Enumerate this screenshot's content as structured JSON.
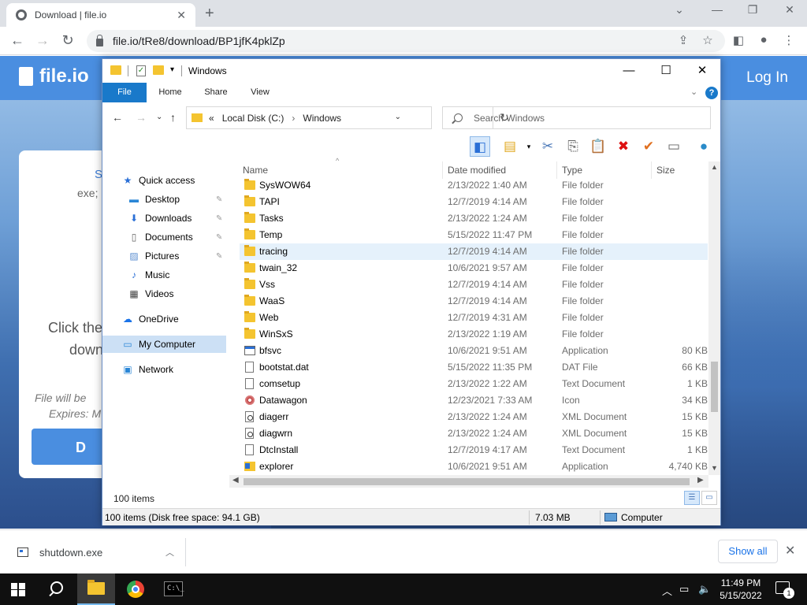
{
  "browser": {
    "tab_title": "Download | file.io",
    "tab_close": "✕",
    "new_tab": "+",
    "url": "file.io/tRe8/download/BP1jfK4pklZp",
    "controls": {
      "minimize": "⌄",
      "minimize2": "—",
      "restore": "❐",
      "close": "✕"
    }
  },
  "page": {
    "logo": "file.io",
    "login": "Log In",
    "card": {
      "line1": "S",
      "line2": "exe;",
      "line3": "Click the",
      "line4": "down",
      "line5": "File will be",
      "line6": "Expires: M",
      "download_btn": "D"
    }
  },
  "explorer": {
    "title": "Windows",
    "ribbon_tabs": [
      "File",
      "Home",
      "Share",
      "View"
    ],
    "help": "?",
    "address": {
      "crumb_prefix": "«",
      "crumbs": [
        "Local Disk (C:)",
        "Windows"
      ]
    },
    "search_placeholder": "Search Windows",
    "nav": {
      "quick_access": "Quick access",
      "desktop": "Desktop",
      "downloads": "Downloads",
      "documents": "Documents",
      "pictures": "Pictures",
      "music": "Music",
      "videos": "Videos",
      "onedrive": "OneDrive",
      "my_computer": "My Computer",
      "network": "Network"
    },
    "columns": {
      "name": "Name",
      "date": "Date modified",
      "type": "Type",
      "size": "Size"
    },
    "files": [
      {
        "name": "SysWOW64",
        "date": "2/13/2022 1:40 AM",
        "type": "File folder",
        "size": "",
        "icon": "folder"
      },
      {
        "name": "TAPI",
        "date": "12/7/2019 4:14 AM",
        "type": "File folder",
        "size": "",
        "icon": "folder"
      },
      {
        "name": "Tasks",
        "date": "2/13/2022 1:24 AM",
        "type": "File folder",
        "size": "",
        "icon": "folder"
      },
      {
        "name": "Temp",
        "date": "5/15/2022 11:47 PM",
        "type": "File folder",
        "size": "",
        "icon": "folder"
      },
      {
        "name": "tracing",
        "date": "12/7/2019 4:14 AM",
        "type": "File folder",
        "size": "",
        "icon": "folder"
      },
      {
        "name": "twain_32",
        "date": "10/6/2021 9:57 AM",
        "type": "File folder",
        "size": "",
        "icon": "folder"
      },
      {
        "name": "Vss",
        "date": "12/7/2019 4:14 AM",
        "type": "File folder",
        "size": "",
        "icon": "folder"
      },
      {
        "name": "WaaS",
        "date": "12/7/2019 4:14 AM",
        "type": "File folder",
        "size": "",
        "icon": "folder"
      },
      {
        "name": "Web",
        "date": "12/7/2019 4:31 AM",
        "type": "File folder",
        "size": "",
        "icon": "folder"
      },
      {
        "name": "WinSxS",
        "date": "2/13/2022 1:19 AM",
        "type": "File folder",
        "size": "",
        "icon": "folder"
      },
      {
        "name": "bfsvc",
        "date": "10/6/2021 9:51 AM",
        "type": "Application",
        "size": "80 KB",
        "icon": "app"
      },
      {
        "name": "bootstat.dat",
        "date": "5/15/2022 11:35 PM",
        "type": "DAT File",
        "size": "66 KB",
        "icon": "doc"
      },
      {
        "name": "comsetup",
        "date": "2/13/2022 1:22 AM",
        "type": "Text Document",
        "size": "1 KB",
        "icon": "doc"
      },
      {
        "name": "Datawagon",
        "date": "12/23/2021 7:33 AM",
        "type": "Icon",
        "size": "34 KB",
        "icon": "icon"
      },
      {
        "name": "diagerr",
        "date": "2/13/2022 1:24 AM",
        "type": "XML Document",
        "size": "15 KB",
        "icon": "xml"
      },
      {
        "name": "diagwrn",
        "date": "2/13/2022 1:24 AM",
        "type": "XML Document",
        "size": "15 KB",
        "icon": "xml"
      },
      {
        "name": "DtcInstall",
        "date": "12/7/2019 4:17 AM",
        "type": "Text Document",
        "size": "1 KB",
        "icon": "doc"
      },
      {
        "name": "explorer",
        "date": "10/6/2021 9:51 AM",
        "type": "Application",
        "size": "4,740 KB",
        "icon": "explorer"
      }
    ],
    "highlighted_file": "tracing",
    "item_count": "100 items",
    "status": {
      "disk": "100 items (Disk free space: 94.1 GB)",
      "size": "7.03 MB",
      "location": "Computer"
    }
  },
  "download_bar": {
    "file": "shutdown.exe",
    "show_all": "Show all",
    "close": "✕"
  },
  "taskbar": {
    "time": "11:49 PM",
    "date": "5/15/2022",
    "notifications": "1"
  },
  "colors": {
    "accent": "#1979ca",
    "brand": "#4a8ee0",
    "selection": "#cce0f5"
  }
}
